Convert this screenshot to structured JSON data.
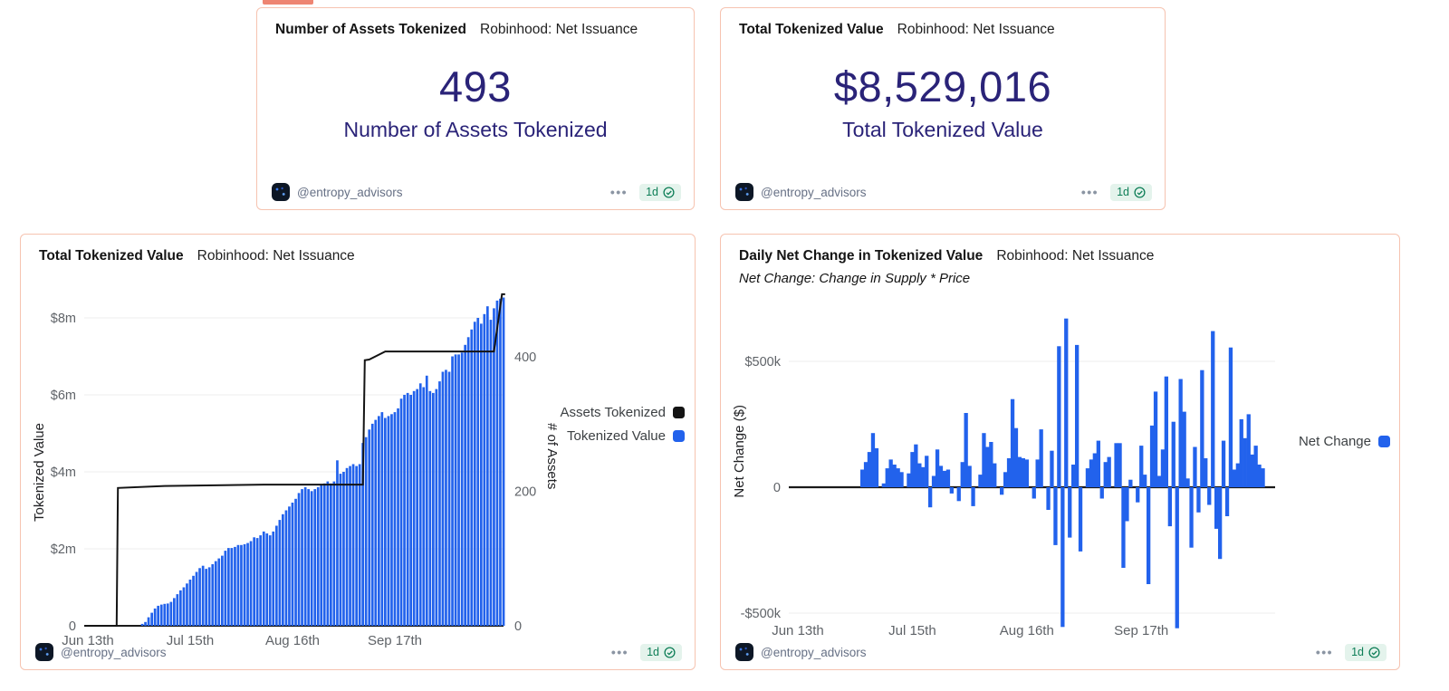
{
  "page": {
    "accent_bar_color": "#ee8572"
  },
  "footer": {
    "handle": "@entropy_advisors",
    "menu": "•••",
    "badge": "1d"
  },
  "cards": {
    "kpi_assets": {
      "title": "Number of Assets Tokenized",
      "subtitle": "Robinhood: Net Issuance",
      "kpi_value": "493",
      "kpi_label": "Number of Assets Tokenized",
      "kpi_color": "#2a2378"
    },
    "kpi_value": {
      "title": "Total Tokenized Value",
      "subtitle": "Robinhood: Net Issuance",
      "kpi_value": "$8,529,016",
      "kpi_label": "Total Tokenized Value",
      "kpi_color": "#2a2378"
    },
    "chart_value": {
      "title": "Total Tokenized Value",
      "subtitle": "Robinhood: Net Issuance"
    },
    "chart_net": {
      "title": "Daily Net Change in Tokenized Value",
      "subtitle": "Robinhood: Net Issuance",
      "note": "Net Change: Change in Supply * Price"
    }
  },
  "chart_data": [
    {
      "type": "bar",
      "title": "Total Tokenized Value",
      "subtitle": "Robinhood: Net Issuance",
      "unit": "$m (bars, left axis) / assets (line, right axis)",
      "ylabel_left": "Tokenized Value",
      "ylabel_right": "# of Assets",
      "grid": "horizontal",
      "legend_position": "right",
      "x_ticks": [
        {
          "day": 0,
          "label": "Jun 13th"
        },
        {
          "day": 32,
          "label": "Jul 15th"
        },
        {
          "day": 64,
          "label": "Aug 16th"
        },
        {
          "day": 96,
          "label": "Sep 17th"
        }
      ],
      "y_ticks": [
        {
          "v": 8,
          "label": "$8m"
        },
        {
          "v": 6,
          "label": "$6m"
        },
        {
          "v": 4,
          "label": "$4m"
        },
        {
          "v": 2,
          "label": "$2m"
        },
        {
          "v": 0,
          "label": "0",
          "strong": true
        }
      ],
      "y2_ticks": [
        {
          "v": 400,
          "label": "400"
        },
        {
          "v": 200,
          "label": "200"
        },
        {
          "v": 0,
          "label": "0"
        }
      ],
      "ylim": [
        0,
        8.75
      ],
      "y2lim": [
        0,
        500
      ],
      "bar_color": "#2262ec",
      "line_color": "#141414",
      "legend": [
        {
          "label": "Assets Tokenized",
          "color": "#141414"
        },
        {
          "label": "Tokenized Value",
          "color": "#2262ec"
        }
      ],
      "values": [
        0,
        0,
        0,
        0,
        0,
        0,
        0,
        0,
        0,
        0,
        0,
        0,
        0,
        0,
        0,
        0,
        0,
        0.05,
        0.1,
        0.22,
        0.34,
        0.45,
        0.52,
        0.55,
        0.57,
        0.58,
        0.62,
        0.72,
        0.82,
        0.92,
        1.0,
        1.1,
        1.2,
        1.3,
        1.4,
        1.5,
        1.56,
        1.48,
        1.52,
        1.6,
        1.68,
        1.75,
        1.82,
        1.95,
        2.02,
        2.02,
        2.05,
        2.1,
        2.1,
        2.12,
        2.15,
        2.2,
        2.3,
        2.28,
        2.35,
        2.45,
        2.4,
        2.35,
        2.45,
        2.6,
        2.75,
        2.9,
        3.0,
        3.1,
        3.2,
        3.3,
        3.45,
        3.55,
        3.6,
        3.55,
        3.5,
        3.55,
        3.6,
        3.65,
        3.7,
        3.75,
        3.7,
        3.75,
        4.3,
        3.95,
        4.0,
        4.1,
        4.15,
        4.2,
        4.15,
        4.2,
        4.75,
        4.9,
        5.1,
        5.25,
        5.35,
        5.45,
        5.55,
        5.4,
        5.45,
        5.5,
        5.55,
        5.65,
        5.9,
        6.0,
        6.05,
        6.0,
        6.1,
        6.15,
        6.3,
        6.2,
        6.5,
        6.1,
        6.05,
        6.15,
        6.35,
        6.6,
        6.65,
        6.6,
        7.0,
        7.05,
        7.05,
        7.1,
        7.3,
        7.5,
        7.7,
        7.9,
        8.0,
        7.85,
        8.1,
        8.3,
        7.95,
        8.25,
        8.45,
        8.5,
        8.53
      ],
      "line": {
        "name": "Assets Tokenized",
        "final_value": 493,
        "points": [
          [
            -1,
            0
          ],
          [
            9,
            0
          ],
          [
            9.4,
            205
          ],
          [
            24,
            208
          ],
          [
            55,
            210
          ],
          [
            86,
            210
          ],
          [
            86.6,
            395
          ],
          [
            88,
            396
          ],
          [
            93,
            408
          ],
          [
            127,
            408
          ],
          [
            129.5,
            493
          ],
          [
            130.5,
            493
          ]
        ]
      }
    },
    {
      "type": "bar",
      "title": "Daily Net Change in Tokenized Value",
      "subtitle": "Robinhood: Net Issuance",
      "note": "Net Change: Change in Supply * Price",
      "unit": "$k",
      "ylabel": "Net Change ($)",
      "grid": "horizontal",
      "legend_position": "right",
      "x_ticks": [
        {
          "day": 0,
          "label": "Jun 13th"
        },
        {
          "day": 32,
          "label": "Jul 15th"
        },
        {
          "day": 64,
          "label": "Aug 16th"
        },
        {
          "day": 96,
          "label": "Sep 17th"
        }
      ],
      "y_ticks": [
        {
          "v": 500,
          "label": "$500k"
        },
        {
          "v": 0,
          "label": "0",
          "strong": true
        },
        {
          "v": -500,
          "label": "-$500k"
        }
      ],
      "ylim": [
        -590,
        720
      ],
      "bar_color": "#2262ec",
      "legend": [
        {
          "label": "Net Change",
          "color": "#2262ec"
        }
      ],
      "values": [
        0,
        0,
        0,
        0,
        0,
        0,
        0,
        0,
        0,
        0,
        0,
        0,
        0,
        0,
        0,
        0,
        0,
        0,
        70,
        100,
        140,
        215,
        155,
        0,
        15,
        75,
        110,
        90,
        75,
        60,
        0,
        55,
        140,
        170,
        95,
        80,
        125,
        -80,
        45,
        150,
        85,
        65,
        70,
        -25,
        0,
        -55,
        100,
        295,
        85,
        -75,
        0,
        50,
        215,
        160,
        180,
        95,
        0,
        -30,
        60,
        115,
        350,
        235,
        120,
        115,
        110,
        0,
        -45,
        110,
        230,
        0,
        -90,
        145,
        -230,
        560,
        -555,
        670,
        -200,
        90,
        565,
        -255,
        0,
        75,
        110,
        135,
        185,
        -45,
        100,
        120,
        0,
        175,
        175,
        -320,
        -135,
        30,
        0,
        -60,
        165,
        50,
        -385,
        245,
        380,
        45,
        150,
        440,
        -155,
        260,
        -560,
        430,
        300,
        35,
        -240,
        160,
        -100,
        465,
        115,
        -70,
        620,
        -165,
        -285,
        185,
        -115,
        555,
        70,
        95,
        270,
        195,
        290,
        130,
        165,
        90,
        75
      ]
    }
  ]
}
